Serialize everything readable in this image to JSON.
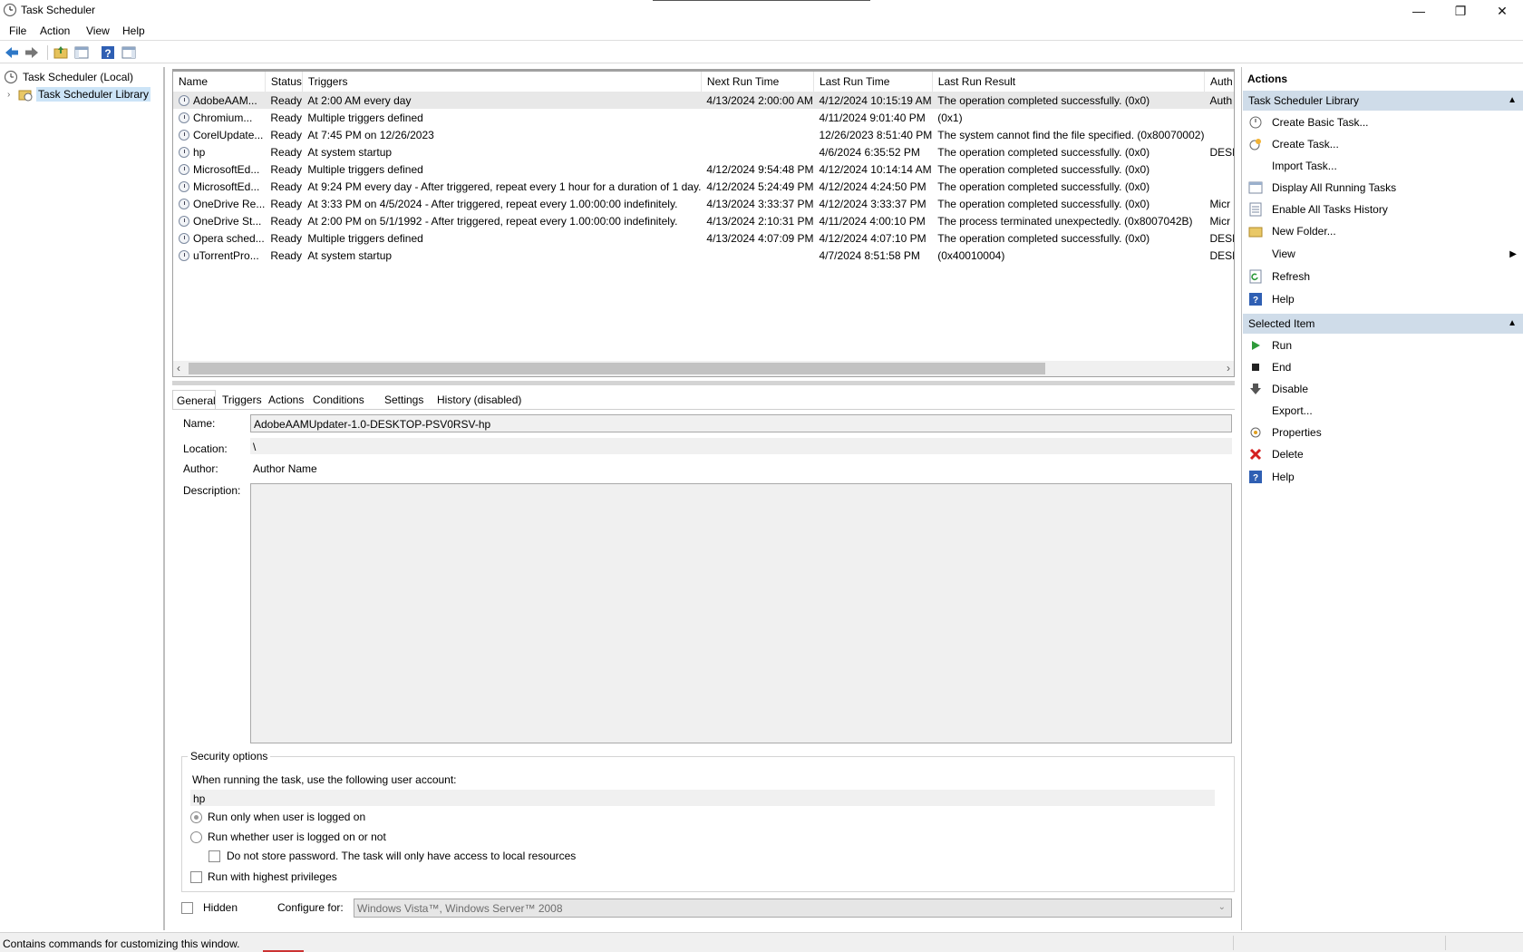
{
  "window": {
    "title": "Task Scheduler",
    "minimize": "—",
    "restore": "❐",
    "close": "✕"
  },
  "menu": [
    "File",
    "Action",
    "View",
    "Help"
  ],
  "tree": {
    "root": "Task Scheduler (Local)",
    "library": "Task Scheduler Library"
  },
  "tasklist": {
    "columns": [
      "Name",
      "Status",
      "Triggers",
      "Next Run Time",
      "Last Run Time",
      "Last Run Result",
      "Auth"
    ],
    "rows": [
      [
        "AdobeAAM...",
        "Ready",
        "At 2:00 AM every day",
        "4/13/2024 2:00:00 AM",
        "4/12/2024 10:15:19 AM",
        "The operation completed successfully. (0x0)",
        "Auth"
      ],
      [
        "Chromium...",
        "Ready",
        "Multiple triggers defined",
        "",
        "4/11/2024 9:01:40 PM",
        "(0x1)",
        ""
      ],
      [
        "CorelUpdate...",
        "Ready",
        "At 7:45 PM on 12/26/2023",
        "",
        "12/26/2023 8:51:40 PM",
        "The system cannot find the file specified. (0x80070002)",
        ""
      ],
      [
        "hp",
        "Ready",
        "At system startup",
        "",
        "4/6/2024 6:35:52 PM",
        "The operation completed successfully. (0x0)",
        "DESK"
      ],
      [
        "MicrosoftEd...",
        "Ready",
        "Multiple triggers defined",
        "4/12/2024 9:54:48 PM",
        "4/12/2024 10:14:14 AM",
        "The operation completed successfully. (0x0)",
        ""
      ],
      [
        "MicrosoftEd...",
        "Ready",
        "At 9:24 PM every day - After triggered, repeat every 1 hour for a duration of 1 day.",
        "4/12/2024 5:24:49 PM",
        "4/12/2024 4:24:50 PM",
        "The operation completed successfully. (0x0)",
        ""
      ],
      [
        "OneDrive Re...",
        "Ready",
        "At 3:33 PM on 4/5/2024 - After triggered, repeat every 1.00:00:00 indefinitely.",
        "4/13/2024 3:33:37 PM",
        "4/12/2024 3:33:37 PM",
        "The operation completed successfully. (0x0)",
        "Micr"
      ],
      [
        "OneDrive St...",
        "Ready",
        "At 2:00 PM on 5/1/1992 - After triggered, repeat every 1.00:00:00 indefinitely.",
        "4/13/2024 2:10:31 PM",
        "4/11/2024 4:00:10 PM",
        "The process terminated unexpectedly. (0x8007042B)",
        "Micr"
      ],
      [
        "Opera sched...",
        "Ready",
        "Multiple triggers defined",
        "4/13/2024 4:07:09 PM",
        "4/12/2024 4:07:10 PM",
        "The operation completed successfully. (0x0)",
        "DESK"
      ],
      [
        "uTorrentPro...",
        "Ready",
        "At system startup",
        "",
        "4/7/2024 8:51:58 PM",
        "(0x40010004)",
        "DESK"
      ]
    ]
  },
  "tabs": [
    "General",
    "Triggers",
    "Actions",
    "Conditions",
    "Settings",
    "History (disabled)"
  ],
  "general": {
    "name_label": "Name:",
    "name_value": "AdobeAAMUpdater-1.0-DESKTOP-PSV0RSV-hp",
    "location_label": "Location:",
    "location_value": "\\",
    "author_label": "Author:",
    "author_value": "Author Name",
    "description_label": "Description:",
    "description_value": ""
  },
  "security": {
    "legend": "Security options",
    "account_prompt": "When running the task, use the following user account:",
    "account": "hp",
    "opt_logged_on": "Run only when user is logged on",
    "opt_whether": "Run whether user is logged on or not",
    "opt_no_password": "Do not store password.  The task will only have access to local resources",
    "opt_highest": "Run with highest privileges"
  },
  "bottom": {
    "hidden_label": "Hidden",
    "configure_label": "Configure for:",
    "configure_value": "Windows Vista™, Windows Server™ 2008"
  },
  "actions": {
    "title": "Actions",
    "section1": "Task Scheduler Library",
    "items1": [
      "Create Basic Task...",
      "Create Task...",
      "Import Task...",
      "Display All Running Tasks",
      "Enable All Tasks History",
      "New Folder...",
      "View",
      "Refresh",
      "Help"
    ],
    "section2": "Selected Item",
    "items2": [
      "Run",
      "End",
      "Disable",
      "Export...",
      "Properties",
      "Delete",
      "Help"
    ]
  },
  "status": {
    "text": "Contains commands for customizing this window."
  }
}
